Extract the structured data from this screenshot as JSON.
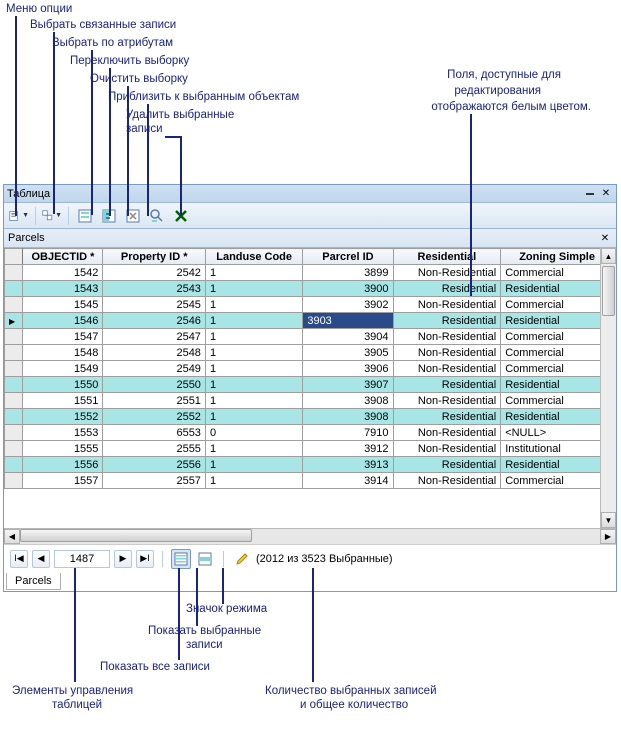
{
  "annotations": {
    "menu_options": "Меню опции",
    "select_related": "Выбрать связанные записи",
    "select_by_attr": "Выбрать по атрибутам",
    "switch_selection": "Переключить выборку",
    "clear_selection": "Очистить выборку",
    "zoom_selected": "Приблизить к выбранным объектам",
    "delete_selected_l1": "Удалить выбранные",
    "delete_selected_l2": "записи",
    "edit_fields_l1": "Поля, доступные для",
    "edit_fields_l2": "редактирования",
    "edit_fields_l3": "отображаются белым цветом.",
    "mode_icon": "Значок режима",
    "show_selected_l1": "Показать выбранные",
    "show_selected_l2": "записи",
    "show_all": "Показать все записи",
    "table_controls_l1": "Элементы управления",
    "table_controls_l2": "таблицей",
    "count_l1": "Количество выбранных записей",
    "count_l2": "и общее количество"
  },
  "window": {
    "title": "Таблица",
    "tab_label": "Parcels",
    "bottom_tab": "Parcels"
  },
  "columns": [
    "OBJECTID *",
    "Property ID *",
    "Landuse Code",
    "Parcrel ID",
    "Residential",
    "Zoning Simple"
  ],
  "rows": [
    {
      "obj": "1542",
      "prop": "2542",
      "lu": "1",
      "pid": "3899",
      "res": "Non-Residential",
      "zon": "Commercial",
      "sel": false
    },
    {
      "obj": "1543",
      "prop": "2543",
      "lu": "1",
      "pid": "3900",
      "res": "Residential",
      "zon": "Residential",
      "sel": true
    },
    {
      "obj": "1545",
      "prop": "2545",
      "lu": "1",
      "pid": "3902",
      "res": "Non-Residential",
      "zon": "Commercial",
      "sel": false
    },
    {
      "obj": "1546",
      "prop": "2546",
      "lu": "1",
      "pid": "3903",
      "res": "Residential",
      "zon": "Residential",
      "sel": true,
      "mark": true,
      "edit": true
    },
    {
      "obj": "1547",
      "prop": "2547",
      "lu": "1",
      "pid": "3904",
      "res": "Non-Residential",
      "zon": "Commercial",
      "sel": false
    },
    {
      "obj": "1548",
      "prop": "2548",
      "lu": "1",
      "pid": "3905",
      "res": "Non-Residential",
      "zon": "Commercial",
      "sel": false
    },
    {
      "obj": "1549",
      "prop": "2549",
      "lu": "1",
      "pid": "3906",
      "res": "Non-Residential",
      "zon": "Commercial",
      "sel": false
    },
    {
      "obj": "1550",
      "prop": "2550",
      "lu": "1",
      "pid": "3907",
      "res": "Residential",
      "zon": "Residential",
      "sel": true
    },
    {
      "obj": "1551",
      "prop": "2551",
      "lu": "1",
      "pid": "3908",
      "res": "Non-Residential",
      "zon": "Commercial",
      "sel": false
    },
    {
      "obj": "1552",
      "prop": "2552",
      "lu": "1",
      "pid": "3908",
      "res": "Residential",
      "zon": "Residential",
      "sel": true
    },
    {
      "obj": "1553",
      "prop": "6553",
      "lu": "0",
      "pid": "7910",
      "res": "Non-Residential",
      "zon": "<NULL>",
      "sel": false
    },
    {
      "obj": "1555",
      "prop": "2555",
      "lu": "1",
      "pid": "3912",
      "res": "Non-Residential",
      "zon": "Institutional",
      "sel": false
    },
    {
      "obj": "1556",
      "prop": "2556",
      "lu": "1",
      "pid": "3913",
      "res": "Residential",
      "zon": "Residential",
      "sel": true
    },
    {
      "obj": "1557",
      "prop": "2557",
      "lu": "1",
      "pid": "3914",
      "res": "Non-Residential",
      "zon": "Commercial",
      "sel": false
    }
  ],
  "footer": {
    "record": "1487",
    "count_text": "(2012 из 3523 Выбранные)"
  }
}
